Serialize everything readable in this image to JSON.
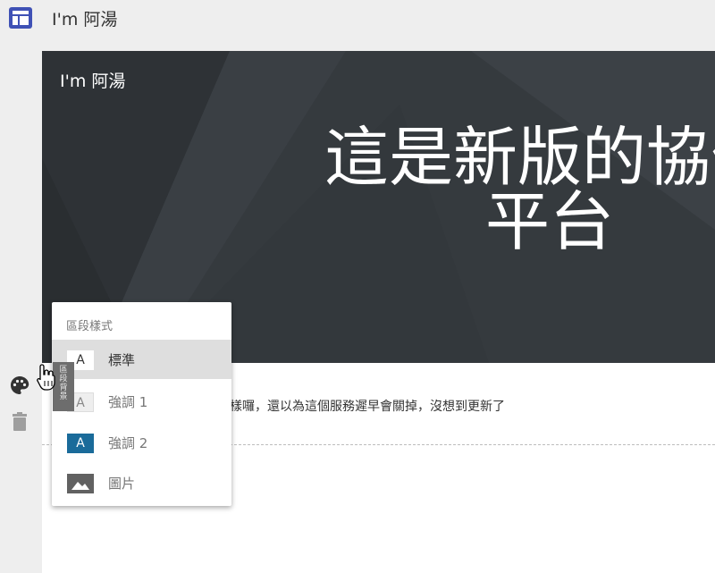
{
  "header": {
    "site_title": "I'm 阿湯",
    "logo_icon": "dashboard-layout-icon",
    "accent_color": "#3f51b5"
  },
  "rail": {
    "palette_icon": "palette-icon",
    "trash_icon": "trash-icon"
  },
  "hero": {
    "brand": "I'm 阿湯",
    "heading": "這是新版的協作\n平台",
    "background_color": "#353a3e"
  },
  "section_2": {
    "body_text": "樣囉，還以為這個服務遲早會關掉，沒想到更新了"
  },
  "style_menu": {
    "title": "區段樣式",
    "items": [
      {
        "swatch": "A",
        "label": "標準",
        "selected": true,
        "swatch_bg": "#ffffff",
        "swatch_fg": "#333333"
      },
      {
        "swatch": "A",
        "label": "強調 1",
        "selected": false,
        "swatch_bg": "#eeeeee",
        "swatch_fg": "#888888"
      },
      {
        "swatch": "A",
        "label": "強調 2",
        "selected": false,
        "swatch_bg": "#1a6b9a",
        "swatch_fg": "#ffffff"
      },
      {
        "swatch": "image-icon",
        "label": "圖片",
        "selected": false,
        "swatch_bg": "#616161",
        "swatch_fg": "#ffffff"
      }
    ]
  },
  "tooltip": {
    "text": "區段背景"
  },
  "cursor": {
    "icon": "hand-pointer-icon"
  }
}
